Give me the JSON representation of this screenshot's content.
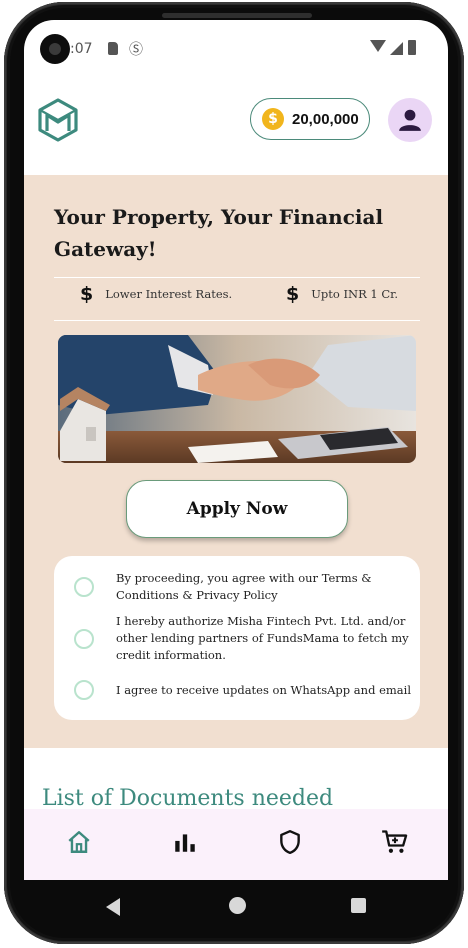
{
  "status_bar": {
    "time": ":07",
    "icons": [
      "camera-icon",
      "sd-card-icon",
      "s-icon",
      "wifi-icon",
      "signal-icon",
      "battery-icon"
    ]
  },
  "header": {
    "logo": "fundsmama-logo",
    "coin_icon": "dollar-coin-icon",
    "coin_symbol": "$",
    "coin_balance": "20,00,000",
    "avatar_icon": "person-icon"
  },
  "hero": {
    "title": "Your Property, Your Financial Gateway!",
    "features": [
      {
        "icon": "dollar-icon",
        "symbol": "$",
        "label": "Lower Interest Rates."
      },
      {
        "icon": "dollar-icon",
        "symbol": "$",
        "label": "Upto INR 1 Cr."
      }
    ],
    "image": "handshake-photo"
  },
  "apply_label": "Apply Now",
  "consents": [
    {
      "text": "By proceeding, you agree with our Terms & Conditions & Privacy Policy",
      "checked": false
    },
    {
      "text": "I hereby authorize Misha Fintech Pvt. Ltd. and/or other lending partners of FundsMama to fetch my credit information.",
      "checked": false
    },
    {
      "text": "I agree to receive updates on WhatsApp and email",
      "checked": false
    }
  ],
  "documents_title": "List of Documents needed",
  "bottom_nav": {
    "items": [
      {
        "icon": "home-icon",
        "active": true
      },
      {
        "icon": "bar-chart-icon",
        "active": false
      },
      {
        "icon": "shield-icon",
        "active": false
      },
      {
        "icon": "cart-icon",
        "active": false
      }
    ]
  },
  "colors": {
    "accent": "#3d8a7e",
    "card_bg": "#f1dfd0",
    "nav_bg": "#fbf1fb",
    "coin": "#f1b51c",
    "avatar_bg": "#ead6f5",
    "radio": "#b9e3cd"
  }
}
